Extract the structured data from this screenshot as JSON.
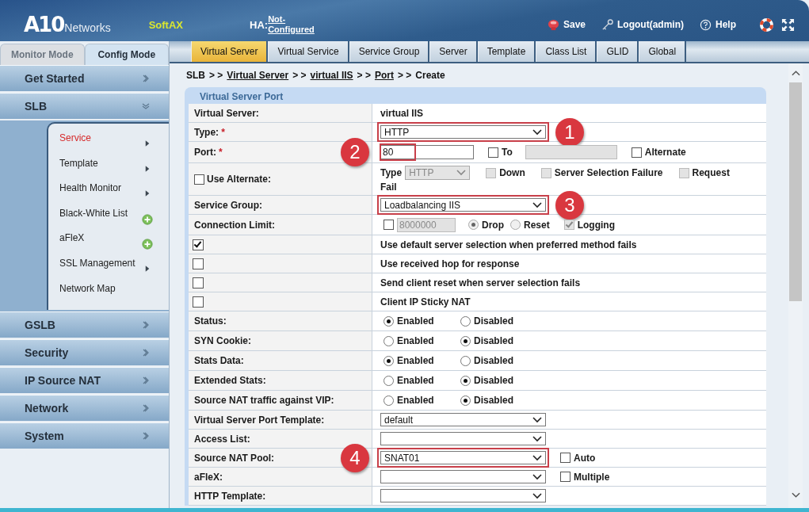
{
  "header": {
    "logo": {
      "mark": "A10",
      "name": "Networks"
    },
    "product": "SoftAX",
    "ha_label": "HA:",
    "ha_value": "Not-Configured",
    "actions": [
      {
        "kind": "save",
        "label": "Save"
      },
      {
        "kind": "logout",
        "label": "Logout(admin)"
      },
      {
        "kind": "help",
        "label": "Help"
      }
    ]
  },
  "mode_tabs": [
    {
      "label": "Monitor Mode",
      "selected": false
    },
    {
      "label": "Config Mode",
      "selected": true
    }
  ],
  "nav": [
    {
      "label": "Get Started",
      "expanded": false
    },
    {
      "label": "SLB",
      "expanded": true,
      "children": [
        {
          "label": "Service",
          "kind": "submenu",
          "selected": true
        },
        {
          "label": "Template",
          "kind": "submenu",
          "selected": false
        },
        {
          "label": "Health Monitor",
          "kind": "submenu",
          "selected": false
        },
        {
          "label": "Black-White List",
          "kind": "add",
          "selected": false
        },
        {
          "label": "aFleX",
          "kind": "add",
          "selected": false
        },
        {
          "label": "SSL Management",
          "kind": "submenu",
          "selected": false
        },
        {
          "label": "Network Map",
          "kind": "plain",
          "selected": false
        }
      ]
    },
    {
      "label": "GSLB",
      "expanded": false
    },
    {
      "label": "Security",
      "expanded": false
    },
    {
      "label": "IP Source NAT",
      "expanded": false
    },
    {
      "label": "Network",
      "expanded": false
    },
    {
      "label": "System",
      "expanded": false
    }
  ],
  "tabs": [
    {
      "label": "Virtual Server",
      "selected": true
    },
    {
      "label": "Virtual Service",
      "selected": false
    },
    {
      "label": "Service Group",
      "selected": false
    },
    {
      "label": "Server",
      "selected": false
    },
    {
      "label": "Template",
      "selected": false
    },
    {
      "label": "Class List",
      "selected": false
    },
    {
      "label": "GLID",
      "selected": false
    },
    {
      "label": "Global",
      "selected": false
    }
  ],
  "breadcrumb": [
    {
      "text": "SLB",
      "kind": "plain"
    },
    {
      "text": "> >",
      "kind": "sep"
    },
    {
      "text": "Virtual Server",
      "kind": "link"
    },
    {
      "text": "> >",
      "kind": "sep"
    },
    {
      "text": "virtual IIS",
      "kind": "link"
    },
    {
      "text": "> >",
      "kind": "sep"
    },
    {
      "text": "Port",
      "kind": "link"
    },
    {
      "text": "> >",
      "kind": "sep"
    },
    {
      "text": "Create",
      "kind": "plain"
    }
  ],
  "panel": {
    "title": "Virtual Server Port",
    "rows": [
      {
        "kind": "text",
        "label": "Virtual Server:",
        "value": "virtual IIS"
      },
      {
        "kind": "select",
        "label": "Type:",
        "marker": "*",
        "value": "HTTP",
        "callout": "1"
      },
      {
        "kind": "port",
        "label": "Port:",
        "marker": "*",
        "value": "80",
        "callout": "2",
        "to": {
          "label": "To",
          "checked": false
        },
        "alternate": {
          "label": "Alternate",
          "checked": false
        }
      },
      {
        "kind": "alternate",
        "label": "Use Alternate:",
        "checked": false,
        "type_label": "Type",
        "type_select": {
          "value": "HTTP",
          "disabled": true
        },
        "options": [
          {
            "label": "Down",
            "checked": false,
            "disabled": true
          },
          {
            "label": "Server Selection Failure",
            "checked": false,
            "disabled": true
          },
          {
            "label": "Request",
            "checked": false,
            "disabled": true
          }
        ],
        "tail": "Fail"
      },
      {
        "kind": "select",
        "label": "Service Group:",
        "value": "Loadbalancing IIS",
        "callout": "3"
      },
      {
        "kind": "limit",
        "label": "Connection Limit:",
        "checked": false,
        "value": "8000000",
        "disabled": true,
        "radios": [
          {
            "label": "Drop",
            "selected": true
          },
          {
            "label": "Reset",
            "selected": false
          }
        ],
        "logging": {
          "label": "Logging",
          "checked": true,
          "disabled": true
        }
      },
      {
        "kind": "check",
        "checked": true,
        "text": "Use default server selection when preferred method fails"
      },
      {
        "kind": "check",
        "checked": false,
        "text": "Use received hop for response"
      },
      {
        "kind": "check",
        "checked": false,
        "text": "Send client reset when server selection fails"
      },
      {
        "kind": "check",
        "checked": false,
        "text": "Client IP Sticky NAT"
      },
      {
        "kind": "radio",
        "label": "Status:",
        "options": [
          {
            "label": "Enabled",
            "selected": true
          },
          {
            "label": "Disabled",
            "selected": false
          }
        ]
      },
      {
        "kind": "radio",
        "label": "SYN Cookie:",
        "options": [
          {
            "label": "Enabled",
            "selected": false
          },
          {
            "label": "Disabled",
            "selected": true
          }
        ]
      },
      {
        "kind": "radio",
        "label": "Stats Data:",
        "options": [
          {
            "label": "Enabled",
            "selected": true
          },
          {
            "label": "Disabled",
            "selected": false
          }
        ]
      },
      {
        "kind": "radio",
        "label": "Extended Stats:",
        "options": [
          {
            "label": "Enabled",
            "selected": false
          },
          {
            "label": "Disabled",
            "selected": true
          }
        ]
      },
      {
        "kind": "radio",
        "label": "Source NAT traffic against VIP:",
        "options": [
          {
            "label": "Enabled",
            "selected": false
          },
          {
            "label": "Disabled",
            "selected": true
          }
        ]
      },
      {
        "kind": "select",
        "label": "Virtual Server Port Template:",
        "value": "default"
      },
      {
        "kind": "select",
        "label": "Access List:"
      },
      {
        "kind": "select",
        "label": "Source NAT Pool:",
        "value": "SNAT01",
        "callout": "4",
        "extra": {
          "label": "Auto",
          "checked": false
        }
      },
      {
        "kind": "select",
        "label": "aFleX:",
        "extra": {
          "label": "Multiple",
          "checked": false
        }
      },
      {
        "kind": "select",
        "label": "HTTP Template:"
      }
    ]
  }
}
